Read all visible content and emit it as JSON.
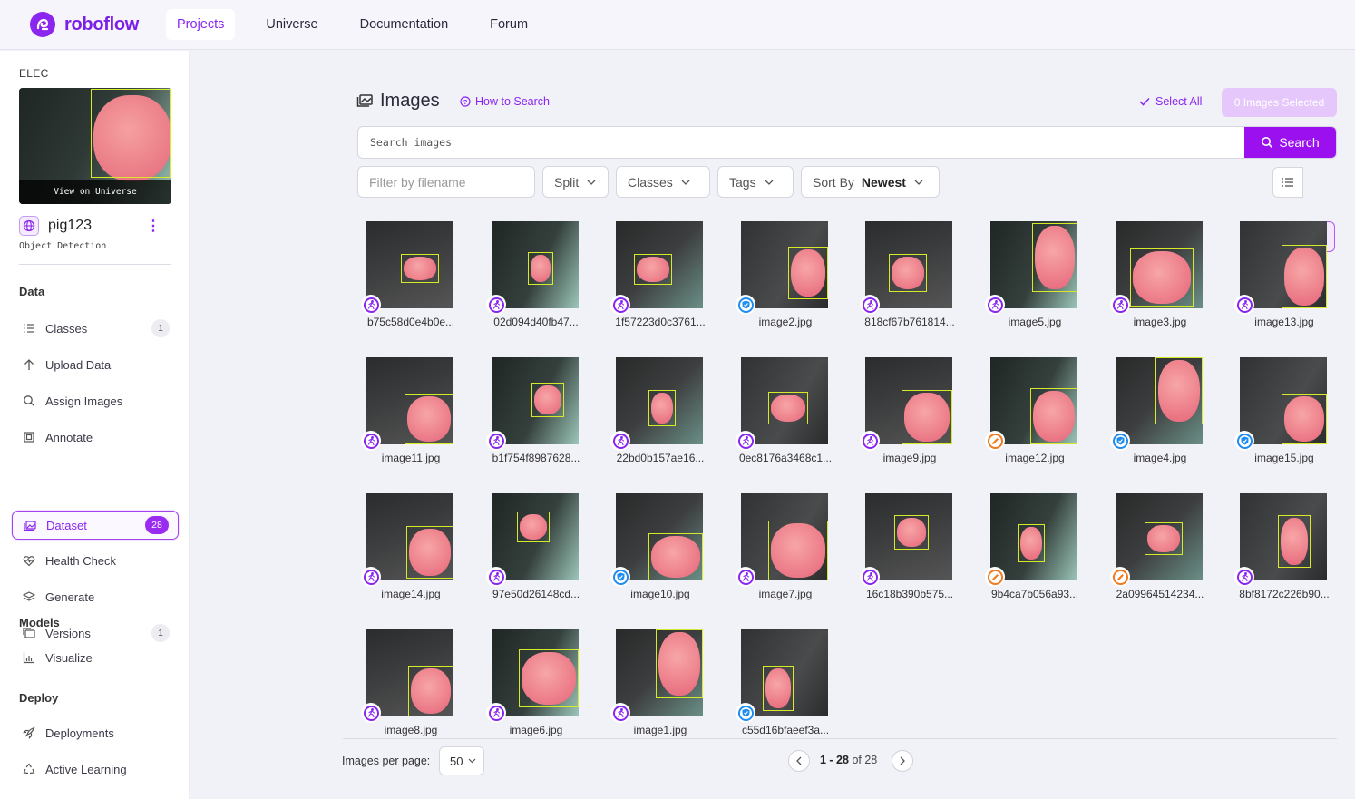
{
  "nav": {
    "brand": "roboflow",
    "links": [
      "Projects",
      "Universe",
      "Documentation",
      "Forum"
    ],
    "active": "Projects"
  },
  "sidebar": {
    "workspace": "ELEC",
    "thumb_caption": "View on Universe",
    "project": {
      "name": "pig123",
      "type": "Object Detection"
    },
    "sections": [
      {
        "title": "Data",
        "items": [
          {
            "label": "Classes",
            "icon": "list-icon",
            "count": "1"
          },
          {
            "label": "Upload Data",
            "icon": "upload-arrow-icon"
          },
          {
            "label": "Assign Images",
            "icon": "search-icon"
          },
          {
            "label": "Annotate",
            "icon": "annotate-frame-icon"
          },
          {
            "label": "Dataset",
            "icon": "images-stack-icon",
            "count": "28",
            "active": true
          },
          {
            "label": "Health Check",
            "icon": "heart-pulse-icon"
          },
          {
            "label": "Generate",
            "icon": "layers-icon"
          },
          {
            "label": "Versions",
            "icon": "versions-icon",
            "count": "1"
          }
        ]
      },
      {
        "title": "Models",
        "items": [
          {
            "label": "Visualize",
            "icon": "bar-chart-icon"
          }
        ]
      },
      {
        "title": "Deploy",
        "items": [
          {
            "label": "Deployments",
            "icon": "rocket-icon"
          },
          {
            "label": "Active Learning",
            "icon": "recycle-icon"
          }
        ]
      }
    ]
  },
  "main": {
    "title": "Images",
    "how_to": "How to Search",
    "select_all": "Select All",
    "selected": "0 Images Selected",
    "search": {
      "placeholder": "Search images",
      "button": "Search"
    },
    "filters": {
      "filename_placeholder": "Filter by filename",
      "split": "Split",
      "classes": "Classes",
      "tags": "Tags",
      "sort_label": "Sort By",
      "sort_value": "Newest"
    }
  },
  "images": [
    {
      "name": "b75c58d0e4b0e...",
      "status": "auto"
    },
    {
      "name": "02d094d40fb47...",
      "status": "auto"
    },
    {
      "name": "1f57223d0c3761...",
      "status": "auto"
    },
    {
      "name": "image2.jpg",
      "status": "approved"
    },
    {
      "name": "818cf67b761814...",
      "status": "auto"
    },
    {
      "name": "image5.jpg",
      "status": "auto"
    },
    {
      "name": "image3.jpg",
      "status": "auto"
    },
    {
      "name": "image13.jpg",
      "status": "auto"
    },
    {
      "name": "image11.jpg",
      "status": "auto"
    },
    {
      "name": "b1f754f8987628...",
      "status": "auto"
    },
    {
      "name": "22bd0b157ae16...",
      "status": "auto"
    },
    {
      "name": "0ec8176a3468c1...",
      "status": "auto"
    },
    {
      "name": "image9.jpg",
      "status": "auto"
    },
    {
      "name": "image12.jpg",
      "status": "edited"
    },
    {
      "name": "image4.jpg",
      "status": "approved"
    },
    {
      "name": "image15.jpg",
      "status": "approved"
    },
    {
      "name": "image14.jpg",
      "status": "auto"
    },
    {
      "name": "97e50d26148cd...",
      "status": "auto"
    },
    {
      "name": "image10.jpg",
      "status": "approved"
    },
    {
      "name": "image7.jpg",
      "status": "auto"
    },
    {
      "name": "16c18b390b575...",
      "status": "auto"
    },
    {
      "name": "9b4ca7b056a93...",
      "status": "edited"
    },
    {
      "name": "2a09964514234...",
      "status": "edited"
    },
    {
      "name": "8bf8172c226b90...",
      "status": "auto"
    },
    {
      "name": "image8.jpg",
      "status": "auto"
    },
    {
      "name": "image6.jpg",
      "status": "auto"
    },
    {
      "name": "image1.jpg",
      "status": "auto"
    },
    {
      "name": "c55d16bfaeef3a...",
      "status": "approved"
    }
  ],
  "footer": {
    "per_page_label": "Images per page:",
    "per_page": "50",
    "range": "1 - 28",
    "of": "of 28"
  }
}
